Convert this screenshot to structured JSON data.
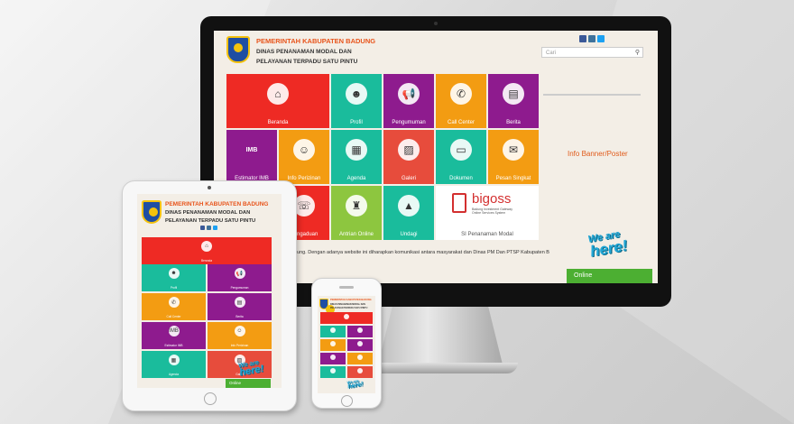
{
  "site": {
    "title1": "PEMERINTAH KABUPATEN BADUNG",
    "title2": "DINAS PENANAMAN MODAL DAN",
    "title3": "PELAYANAN TERPADU SATU PINTU"
  },
  "search": {
    "placeholder": "Cari"
  },
  "colors": {
    "red": "#ee2a24",
    "teal": "#1abc9c",
    "purple": "#8e1b8e",
    "orange": "#f39c12",
    "green": "#8dc63f",
    "coral": "#e74c3c",
    "grey": "#bdbdbd"
  },
  "tiles": [
    {
      "label": "Beranda",
      "icon": "home-icon",
      "glyph": "⌂"
    },
    {
      "label": "Profil",
      "icon": "user-icon",
      "glyph": "☻"
    },
    {
      "label": "Pengumuman",
      "icon": "megaphone-icon",
      "glyph": "📢"
    },
    {
      "label": "Call Center",
      "icon": "phone-icon",
      "glyph": "✆"
    },
    {
      "label": "Berita",
      "icon": "newspaper-icon",
      "glyph": "▤"
    },
    {
      "label": "Estimator IMB",
      "icon": "imb-icon",
      "glyph": "IMB"
    },
    {
      "label": "Info Perizinan",
      "icon": "document-user-icon",
      "glyph": "☺"
    },
    {
      "label": "Agenda",
      "icon": "calendar-icon",
      "glyph": "▦"
    },
    {
      "label": "Galeri",
      "icon": "image-icon",
      "glyph": "▨"
    },
    {
      "label": "Dokumen",
      "icon": "folder-icon",
      "glyph": "▭"
    },
    {
      "label": "Pesan Singkat",
      "icon": "chat-icon",
      "glyph": "✉"
    },
    {
      "label": "Pengaduan",
      "icon": "complaint-icon",
      "glyph": "☏"
    },
    {
      "label": "Antrian Online",
      "icon": "queue-icon",
      "glyph": "♜"
    },
    {
      "label": "Undagi",
      "icon": "undagi-icon",
      "glyph": "▲"
    },
    {
      "label": "SI Penanaman Modal",
      "icon": "bigoss-icon",
      "glyph": ""
    }
  ],
  "bigoss": {
    "name": "bigoss",
    "tagline1": "Badung Investment Gateway",
    "tagline2": "Online Services System"
  },
  "banner": {
    "label": "Info Banner/Poster"
  },
  "marquee": "kabupaten Badung. Dengan adanya website ini diharapkan komunikasi antara masyarakat dan Dinas PM Dan PTSP Kabupaten B",
  "we_are_here": {
    "line1": "We are",
    "line2": "here!"
  },
  "online": {
    "label": "Online"
  },
  "tablet": {
    "tiles": [
      "Beranda",
      "Profil",
      "Pengumuman",
      "Call Center",
      "Berita",
      "Estimator IMB",
      "Info Perizinan",
      "Agenda",
      "Galeri"
    ],
    "bottom_label": "Online"
  }
}
